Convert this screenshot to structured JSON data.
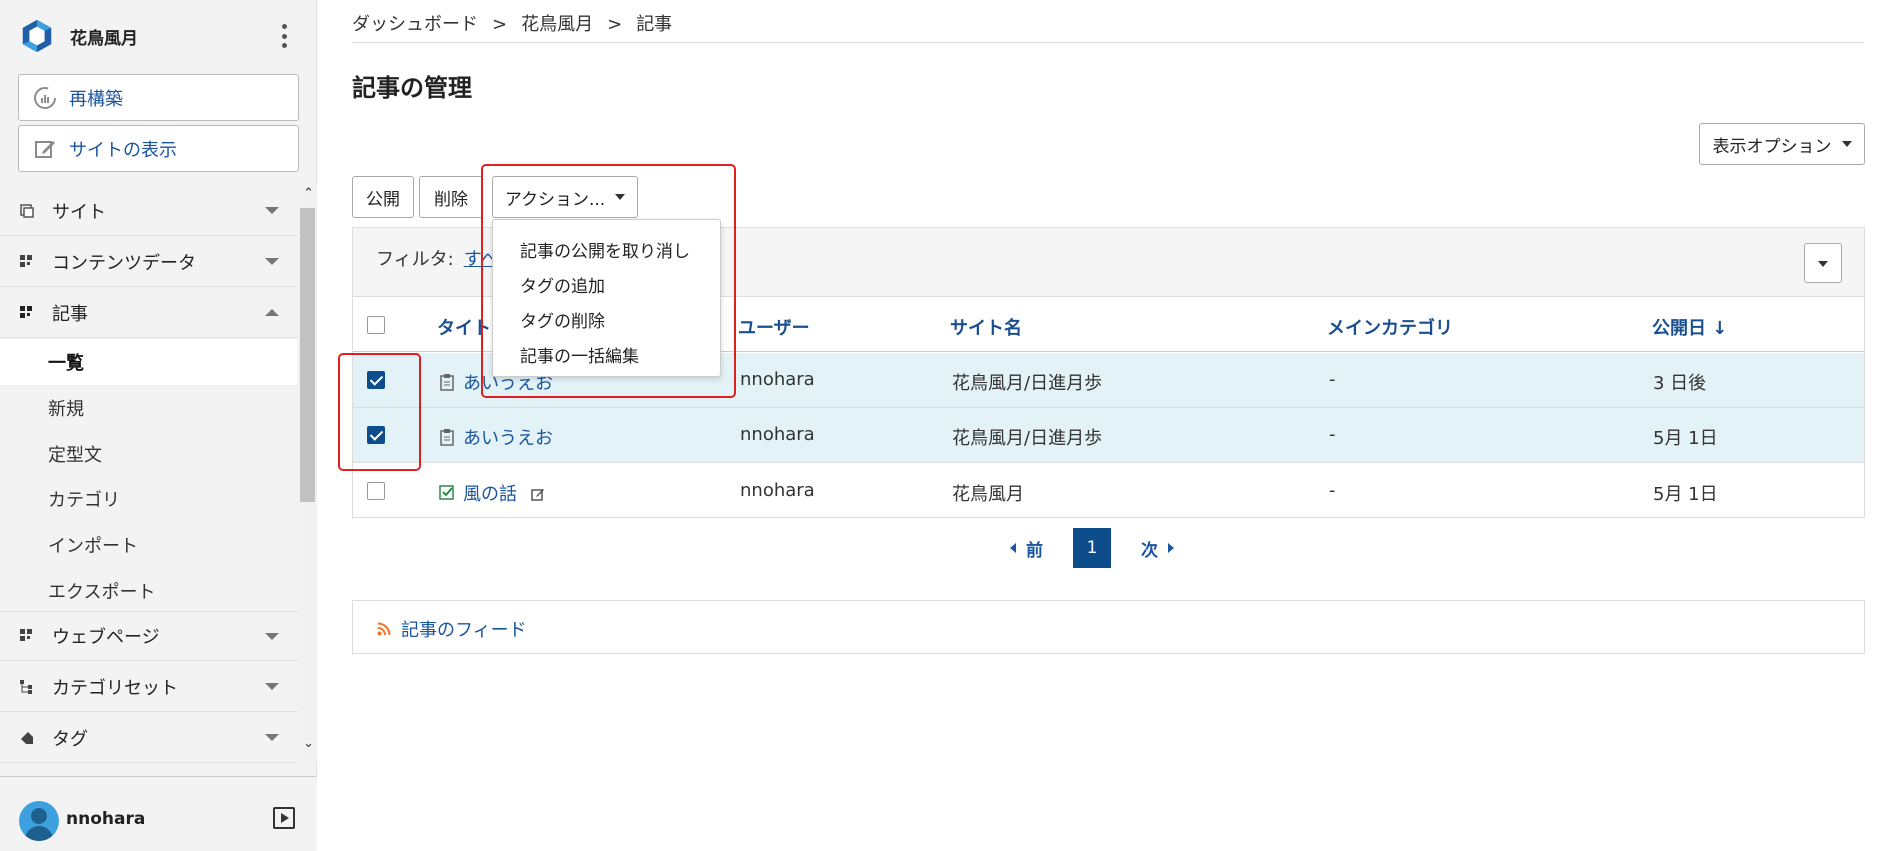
{
  "app": {
    "site_name": "花鳥風月"
  },
  "sidebar": {
    "rebuild_label": "再構築",
    "view_site_label": "サイトの表示",
    "nav": [
      {
        "label": "サイト",
        "expanded": false
      },
      {
        "label": "コンテンツデータ",
        "expanded": false
      },
      {
        "label": "記事",
        "expanded": true
      },
      {
        "label": "ウェブページ",
        "expanded": false
      },
      {
        "label": "カテゴリセット",
        "expanded": false
      },
      {
        "label": "タグ",
        "expanded": false
      }
    ],
    "sub_items": [
      "一覧",
      "新規",
      "定型文",
      "カテゴリ",
      "インポート",
      "エクスポート"
    ],
    "active_sub": "一覧",
    "user": "nnohara"
  },
  "breadcrumb": [
    "ダッシュボード",
    "花鳥風月",
    "記事"
  ],
  "breadcrumb_sep": ">",
  "page_title": "記事の管理",
  "display_options_label": "表示オプション",
  "toolbar": {
    "publish_label": "公開",
    "delete_label": "削除",
    "actions_label": "アクション..."
  },
  "actions_menu": [
    "記事の公開を取り消し",
    "タグの追加",
    "タグの削除",
    "記事の一括編集"
  ],
  "filter": {
    "label": "フィルタ:",
    "value": "すべ"
  },
  "table": {
    "columns": [
      "タイトル",
      "ユーザー",
      "サイト名",
      "メインカテゴリ",
      "公開日"
    ],
    "sort_indicator": "↓",
    "rows": [
      {
        "checked": true,
        "status": "scheduled",
        "title": "あいうえお",
        "user": "nnohara",
        "site": "花鳥風月/日進月歩",
        "category": "-",
        "date": "3 日後"
      },
      {
        "checked": true,
        "status": "scheduled",
        "title": "あいうえお",
        "user": "nnohara",
        "site": "花鳥風月/日進月歩",
        "category": "-",
        "date": "5月 1日"
      },
      {
        "checked": false,
        "status": "published",
        "title": "風の話",
        "user": "nnohara",
        "site": "花鳥風月",
        "category": "-",
        "date": "5月 1日"
      }
    ]
  },
  "pager": {
    "prev": "前",
    "current": "1",
    "next": "次"
  },
  "feed_label": "記事のフィード",
  "colors": {
    "accent": "#0d4d8c",
    "link": "#1a55a0",
    "highlight": "#e02020",
    "selected_row": "#e2f2f6"
  }
}
